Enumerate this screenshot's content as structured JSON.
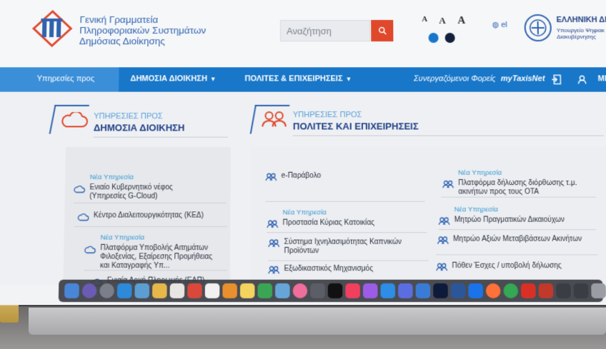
{
  "header": {
    "org_line1": "Γενική Γραμματεία",
    "org_line2": "Πληροφοριακών Συστημάτων",
    "org_line3": "Δημόσιας Διοίκησης",
    "search": {
      "placeholder": "Αναζήτηση"
    },
    "font_sizes": [
      "A",
      "A",
      "A"
    ],
    "language": "el",
    "gov_title": "ΕΛΛΗΝΙΚΗ ΔΗ",
    "gov_sub_line1": "Υπουργείο Ψηφιακ",
    "gov_sub_line2": "Διακυβέρνησης"
  },
  "nav": {
    "services_for": "Υπηρεσίες προς",
    "public_admin": "ΔΗΜΟΣΙΑ ΔΙΟΙΚΗΣΗ",
    "citizens_business": "ΠΟΛΙΤΕΣ & ΕΠΙΧΕΙΡΗΣΕΙΣ",
    "partners": "Συνεργαζόμενοι Φορείς",
    "mytaxisnet": "myTaxisNet",
    "menu_cut": "ΜΕ"
  },
  "sections": {
    "admin": {
      "kicker": "ΥΠΗΡΕΣΙΕΣ ΠΡΟΣ",
      "title": "ΔΗΜΟΣΙΑ ΔΙΟΙΚΗΣΗ"
    },
    "citizens": {
      "kicker": "ΥΠΗΡΕΣΙΕΣ ΠΡΟΣ",
      "title": "ΠΟΛΙΤΕΣ ΚΑΙ ΕΠΙΧΕΙΡΗΣΕΙΣ"
    }
  },
  "new_service_badge": "Νέα Υπηρεσία",
  "admin_services": [
    {
      "line1": "Ενιαίο Κυβερνητικό νέφος",
      "line2": "(Υπηρεσίες G-Cloud)",
      "is_new": true
    },
    {
      "line1": "Κέντρο Διαλειτουργικότητας (ΚΕΔ)",
      "line2": "",
      "is_new": false
    },
    {
      "line1": "Πλατφόρμα Υποβολής Αιτημάτων",
      "line2": "Φιλοξενίας, Εξαίρεσης Προμήθειας",
      "line3": "και Καταγραφής Υπ...",
      "is_new": true
    },
    {
      "line1": "Ενιαία Αρχή Πληρωμής (ΕΑΠ)",
      "line2": "",
      "is_new": false
    }
  ],
  "citizen_services_col1": [
    {
      "line1": "e-Παράβολο",
      "line2": "",
      "is_new": false
    },
    {
      "line1": "Προστασία Κύριας Κατοικίας",
      "line2": "",
      "is_new": true
    },
    {
      "line1": "Σύστημα Ιχνηλασιμότητας Καπνικών",
      "line2": "Προϊόντων",
      "is_new": false
    },
    {
      "line1": "Εξωδικαστικός Μηχανισμός",
      "line2": "",
      "is_new": false
    }
  ],
  "citizen_services_col2": [
    {
      "line1": "Πλατφόρμα δήλωσης διόρθωσης τ.μ.",
      "line2": "ακινήτων προς τους ΟΤΑ",
      "is_new": true
    },
    {
      "line1": "Μητρώο Πραγματικών Δικαιούχων",
      "line2": "",
      "is_new": true
    },
    {
      "line1": "Μητρώο Αξιών Μεταβιβάσεων Ακινήτων",
      "line2": "",
      "is_new": false
    },
    {
      "line1": "Πόθεν Έσχες / υποβολή δήλωσης",
      "line2": "",
      "is_new": false
    }
  ],
  "colors": {
    "nav_blue": "#1877c9",
    "title_blue": "#1f3f86",
    "accent_orange": "#e0482b",
    "new_badge": "#3a9ad1"
  }
}
